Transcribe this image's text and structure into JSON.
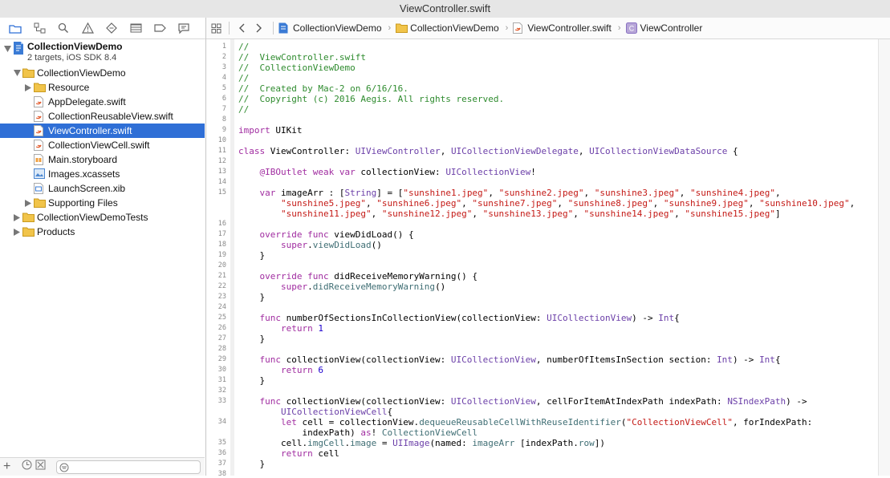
{
  "window": {
    "title": "ViewController.swift"
  },
  "navigator": {
    "toolbar_icons": [
      "folder-icon",
      "symbol-icon",
      "search-icon",
      "warning-icon",
      "test-icon",
      "debug-icon",
      "breakpoint-icon",
      "report-icon"
    ],
    "project": {
      "name": "CollectionViewDemo",
      "subtitle": "2 targets, iOS SDK 8.4"
    },
    "items": [
      {
        "label": "CollectionViewDemo",
        "icon": "folder-icon",
        "indent": 1,
        "disclosure": "open",
        "selected": false
      },
      {
        "label": "Resource",
        "icon": "folder-icon",
        "indent": 2,
        "disclosure": "closed",
        "selected": false
      },
      {
        "label": "AppDelegate.swift",
        "icon": "swift-file-icon",
        "indent": 2,
        "disclosure": "",
        "selected": false
      },
      {
        "label": "CollectionReusableView.swift",
        "icon": "swift-file-icon",
        "indent": 2,
        "disclosure": "",
        "selected": false
      },
      {
        "label": "ViewController.swift",
        "icon": "swift-file-icon",
        "indent": 2,
        "disclosure": "",
        "selected": true
      },
      {
        "label": "CollectionViewCell.swift",
        "icon": "swift-file-icon",
        "indent": 2,
        "disclosure": "",
        "selected": false
      },
      {
        "label": "Main.storyboard",
        "icon": "storyboard-icon",
        "indent": 2,
        "disclosure": "",
        "selected": false
      },
      {
        "label": "Images.xcassets",
        "icon": "assets-icon",
        "indent": 2,
        "disclosure": "",
        "selected": false
      },
      {
        "label": "LaunchScreen.xib",
        "icon": "xib-icon",
        "indent": 2,
        "disclosure": "",
        "selected": false
      },
      {
        "label": "Supporting Files",
        "icon": "folder-icon",
        "indent": 2,
        "disclosure": "closed",
        "selected": false
      },
      {
        "label": "CollectionViewDemoTests",
        "icon": "folder-icon",
        "indent": 1,
        "disclosure": "closed",
        "selected": false
      },
      {
        "label": "Products",
        "icon": "folder-icon",
        "indent": 1,
        "disclosure": "closed",
        "selected": false
      }
    ]
  },
  "jumpbar": {
    "crumbs": [
      {
        "label": "CollectionViewDemo",
        "icon": "project-icon"
      },
      {
        "label": "CollectionViewDemo",
        "icon": "folder-icon"
      },
      {
        "label": "ViewController.swift",
        "icon": "swift-file-icon"
      },
      {
        "label": "ViewController",
        "icon": "class-icon"
      }
    ]
  },
  "editor": {
    "lines": [
      {
        "n": "1",
        "tokens": [
          {
            "t": "//",
            "c": "com"
          }
        ]
      },
      {
        "n": "2",
        "tokens": [
          {
            "t": "//  ViewController.swift",
            "c": "com"
          }
        ]
      },
      {
        "n": "3",
        "tokens": [
          {
            "t": "//  CollectionViewDemo",
            "c": "com"
          }
        ]
      },
      {
        "n": "4",
        "tokens": [
          {
            "t": "//",
            "c": "com"
          }
        ]
      },
      {
        "n": "5",
        "tokens": [
          {
            "t": "//  Created by Mac-2 on 6/16/16.",
            "c": "com"
          }
        ]
      },
      {
        "n": "6",
        "tokens": [
          {
            "t": "//  Copyright (c) 2016 Aegis. All rights reserved.",
            "c": "com"
          }
        ]
      },
      {
        "n": "7",
        "tokens": [
          {
            "t": "//",
            "c": "com"
          }
        ]
      },
      {
        "n": "8",
        "tokens": []
      },
      {
        "n": "9",
        "tokens": [
          {
            "t": "import",
            "c": "kw"
          },
          {
            "t": " UIKit",
            "c": ""
          }
        ]
      },
      {
        "n": "10",
        "tokens": []
      },
      {
        "n": "11",
        "tokens": [
          {
            "t": "class",
            "c": "kw"
          },
          {
            "t": " ViewController: ",
            "c": ""
          },
          {
            "t": "UIViewController",
            "c": "type"
          },
          {
            "t": ", ",
            "c": ""
          },
          {
            "t": "UICollectionViewDelegate",
            "c": "type"
          },
          {
            "t": ", ",
            "c": ""
          },
          {
            "t": "UICollectionViewDataSource",
            "c": "type"
          },
          {
            "t": " {",
            "c": ""
          }
        ]
      },
      {
        "n": "12",
        "tokens": []
      },
      {
        "n": "13",
        "tokens": [
          {
            "t": "    @IBOutlet",
            "c": "kw"
          },
          {
            "t": " ",
            "c": ""
          },
          {
            "t": "weak",
            "c": "kw"
          },
          {
            "t": " ",
            "c": ""
          },
          {
            "t": "var",
            "c": "kw"
          },
          {
            "t": " collectionView: ",
            "c": ""
          },
          {
            "t": "UICollectionView",
            "c": "type"
          },
          {
            "t": "!",
            "c": ""
          }
        ]
      },
      {
        "n": "14",
        "tokens": []
      },
      {
        "n": "15",
        "tokens": [
          {
            "t": "    ",
            "c": ""
          },
          {
            "t": "var",
            "c": "kw"
          },
          {
            "t": " imageArr : [",
            "c": ""
          },
          {
            "t": "String",
            "c": "type"
          },
          {
            "t": "] = [",
            "c": ""
          },
          {
            "t": "\"sunshine1.jpeg\"",
            "c": "str"
          },
          {
            "t": ", ",
            "c": ""
          },
          {
            "t": "\"sunshine2.jpeg\"",
            "c": "str"
          },
          {
            "t": ", ",
            "c": ""
          },
          {
            "t": "\"sunshine3.jpeg\"",
            "c": "str"
          },
          {
            "t": ", ",
            "c": ""
          },
          {
            "t": "\"sunshine4.jpeg\"",
            "c": "str"
          },
          {
            "t": ",",
            "c": ""
          }
        ]
      },
      {
        "n": "",
        "tokens": [
          {
            "t": "        ",
            "c": ""
          },
          {
            "t": "\"sunshine5.jpeg\"",
            "c": "str"
          },
          {
            "t": ", ",
            "c": ""
          },
          {
            "t": "\"sunshine6.jpeg\"",
            "c": "str"
          },
          {
            "t": ", ",
            "c": ""
          },
          {
            "t": "\"sunshine7.jpeg\"",
            "c": "str"
          },
          {
            "t": ", ",
            "c": ""
          },
          {
            "t": "\"sunshine8.jpeg\"",
            "c": "str"
          },
          {
            "t": ", ",
            "c": ""
          },
          {
            "t": "\"sunshine9.jpeg\"",
            "c": "str"
          },
          {
            "t": ", ",
            "c": ""
          },
          {
            "t": "\"sunshine10.jpeg\"",
            "c": "str"
          },
          {
            "t": ",",
            "c": ""
          }
        ]
      },
      {
        "n": "",
        "tokens": [
          {
            "t": "        ",
            "c": ""
          },
          {
            "t": "\"sunshine11.jpeg\"",
            "c": "str"
          },
          {
            "t": ", ",
            "c": ""
          },
          {
            "t": "\"sunshine12.jpeg\"",
            "c": "str"
          },
          {
            "t": ", ",
            "c": ""
          },
          {
            "t": "\"sunshine13.jpeg\"",
            "c": "str"
          },
          {
            "t": ", ",
            "c": ""
          },
          {
            "t": "\"sunshine14.jpeg\"",
            "c": "str"
          },
          {
            "t": ", ",
            "c": ""
          },
          {
            "t": "\"sunshine15.jpeg\"",
            "c": "str"
          },
          {
            "t": "]",
            "c": ""
          }
        ]
      },
      {
        "n": "16",
        "tokens": []
      },
      {
        "n": "17",
        "tokens": [
          {
            "t": "    ",
            "c": ""
          },
          {
            "t": "override",
            "c": "kw"
          },
          {
            "t": " ",
            "c": ""
          },
          {
            "t": "func",
            "c": "kw"
          },
          {
            "t": " viewDidLoad() {",
            "c": ""
          }
        ]
      },
      {
        "n": "18",
        "tokens": [
          {
            "t": "        ",
            "c": ""
          },
          {
            "t": "super",
            "c": "kw"
          },
          {
            "t": ".",
            "c": ""
          },
          {
            "t": "viewDidLoad",
            "c": "fn"
          },
          {
            "t": "()",
            "c": ""
          }
        ]
      },
      {
        "n": "19",
        "tokens": [
          {
            "t": "    }",
            "c": ""
          }
        ]
      },
      {
        "n": "20",
        "tokens": []
      },
      {
        "n": "21",
        "tokens": [
          {
            "t": "    ",
            "c": ""
          },
          {
            "t": "override",
            "c": "kw"
          },
          {
            "t": " ",
            "c": ""
          },
          {
            "t": "func",
            "c": "kw"
          },
          {
            "t": " didReceiveMemoryWarning() {",
            "c": ""
          }
        ]
      },
      {
        "n": "22",
        "tokens": [
          {
            "t": "        ",
            "c": ""
          },
          {
            "t": "super",
            "c": "kw"
          },
          {
            "t": ".",
            "c": ""
          },
          {
            "t": "didReceiveMemoryWarning",
            "c": "fn"
          },
          {
            "t": "()",
            "c": ""
          }
        ]
      },
      {
        "n": "23",
        "tokens": [
          {
            "t": "    }",
            "c": ""
          }
        ]
      },
      {
        "n": "24",
        "tokens": []
      },
      {
        "n": "25",
        "tokens": [
          {
            "t": "    ",
            "c": ""
          },
          {
            "t": "func",
            "c": "kw"
          },
          {
            "t": " numberOfSectionsInCollectionView(collectionView: ",
            "c": ""
          },
          {
            "t": "UICollectionView",
            "c": "type"
          },
          {
            "t": ") -> ",
            "c": ""
          },
          {
            "t": "Int",
            "c": "type"
          },
          {
            "t": "{",
            "c": ""
          }
        ]
      },
      {
        "n": "26",
        "tokens": [
          {
            "t": "        ",
            "c": ""
          },
          {
            "t": "return",
            "c": "kw"
          },
          {
            "t": " ",
            "c": ""
          },
          {
            "t": "1",
            "c": "num"
          }
        ]
      },
      {
        "n": "27",
        "tokens": [
          {
            "t": "    }",
            "c": ""
          }
        ]
      },
      {
        "n": "28",
        "tokens": []
      },
      {
        "n": "29",
        "tokens": [
          {
            "t": "    ",
            "c": ""
          },
          {
            "t": "func",
            "c": "kw"
          },
          {
            "t": " collectionView(collectionView: ",
            "c": ""
          },
          {
            "t": "UICollectionView",
            "c": "type"
          },
          {
            "t": ", numberOfItemsInSection section: ",
            "c": ""
          },
          {
            "t": "Int",
            "c": "type"
          },
          {
            "t": ") -> ",
            "c": ""
          },
          {
            "t": "Int",
            "c": "type"
          },
          {
            "t": "{",
            "c": ""
          }
        ]
      },
      {
        "n": "30",
        "tokens": [
          {
            "t": "        ",
            "c": ""
          },
          {
            "t": "return",
            "c": "kw"
          },
          {
            "t": " ",
            "c": ""
          },
          {
            "t": "6",
            "c": "num"
          }
        ]
      },
      {
        "n": "31",
        "tokens": [
          {
            "t": "    }",
            "c": ""
          }
        ]
      },
      {
        "n": "32",
        "tokens": []
      },
      {
        "n": "33",
        "tokens": [
          {
            "t": "    ",
            "c": ""
          },
          {
            "t": "func",
            "c": "kw"
          },
          {
            "t": " collectionView(collectionView: ",
            "c": ""
          },
          {
            "t": "UICollectionView",
            "c": "type"
          },
          {
            "t": ", cellForItemAtIndexPath indexPath: ",
            "c": ""
          },
          {
            "t": "NSIndexPath",
            "c": "type"
          },
          {
            "t": ") ->",
            "c": ""
          }
        ]
      },
      {
        "n": "",
        "tokens": [
          {
            "t": "        ",
            "c": ""
          },
          {
            "t": "UICollectionViewCell",
            "c": "type"
          },
          {
            "t": "{",
            "c": ""
          }
        ]
      },
      {
        "n": "34",
        "tokens": [
          {
            "t": "        ",
            "c": ""
          },
          {
            "t": "let",
            "c": "kw"
          },
          {
            "t": " cell = collectionView.",
            "c": ""
          },
          {
            "t": "dequeueReusableCellWithReuseIdentifier",
            "c": "fn"
          },
          {
            "t": "(",
            "c": ""
          },
          {
            "t": "\"CollectionViewCell\"",
            "c": "str"
          },
          {
            "t": ", forIndexPath:",
            "c": ""
          }
        ]
      },
      {
        "n": "",
        "tokens": [
          {
            "t": "            indexPath) ",
            "c": ""
          },
          {
            "t": "as",
            "c": "kw"
          },
          {
            "t": "! ",
            "c": ""
          },
          {
            "t": "CollectionViewCell",
            "c": "fn"
          }
        ]
      },
      {
        "n": "35",
        "tokens": [
          {
            "t": "        cell.",
            "c": ""
          },
          {
            "t": "imgCell",
            "c": "fn"
          },
          {
            "t": ".",
            "c": ""
          },
          {
            "t": "image",
            "c": "fn"
          },
          {
            "t": " = ",
            "c": ""
          },
          {
            "t": "UIImage",
            "c": "type"
          },
          {
            "t": "(named: ",
            "c": ""
          },
          {
            "t": "imageArr",
            "c": "fn"
          },
          {
            "t": " [indexPath.",
            "c": ""
          },
          {
            "t": "row",
            "c": "fn"
          },
          {
            "t": "])",
            "c": ""
          }
        ]
      },
      {
        "n": "36",
        "tokens": [
          {
            "t": "        ",
            "c": ""
          },
          {
            "t": "return",
            "c": "kw"
          },
          {
            "t": " cell",
            "c": ""
          }
        ]
      },
      {
        "n": "37",
        "tokens": [
          {
            "t": "    }",
            "c": ""
          }
        ]
      },
      {
        "n": "38",
        "tokens": []
      }
    ]
  },
  "colors": {
    "selection": "#2f6fd6",
    "comment": "#2e8b2e",
    "keyword": "#a02ca0",
    "type": "#6b3fa8",
    "string": "#c41a16",
    "number": "#1c00cf"
  }
}
